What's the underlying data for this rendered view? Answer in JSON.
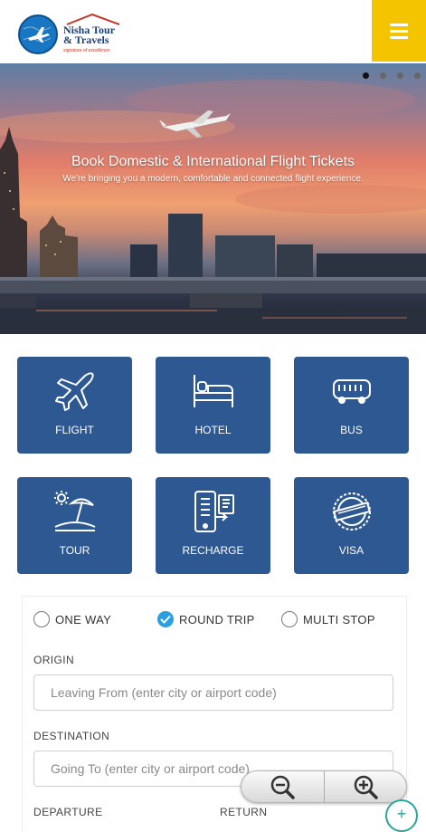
{
  "brand": {
    "name_line1": "Nisha Tour",
    "name_line2": "& Travels",
    "tagline": "signature of excellence"
  },
  "hero": {
    "title": "Book Domestic & International Flight Tickets",
    "subtitle": "We're bringing you a modern, comfortable and connected flight experience.",
    "slide_count": 4,
    "active_slide": 1
  },
  "services": [
    {
      "label": "FLIGHT",
      "icon": "airplane-icon"
    },
    {
      "label": "HOTEL",
      "icon": "bed-icon"
    },
    {
      "label": "BUS",
      "icon": "bus-icon"
    },
    {
      "label": "TOUR",
      "icon": "beach-umbrella-icon"
    },
    {
      "label": "RECHARGE",
      "icon": "phone-recharge-icon"
    },
    {
      "label": "VISA",
      "icon": "visa-stamp-icon"
    }
  ],
  "search_form": {
    "trip_types": [
      {
        "label": "ONE WAY",
        "selected": false
      },
      {
        "label": "ROUND TRIP",
        "selected": true
      },
      {
        "label": "MULTI STOP",
        "selected": false
      }
    ],
    "origin_label": "ORIGIN",
    "origin_placeholder": "Leaving From (enter city or airport code)",
    "destination_label": "DESTINATION",
    "destination_placeholder": "Going To (enter city or airport code)",
    "departure_label": "DEPARTURE",
    "return_label": "RETURN"
  },
  "colors": {
    "tile_blue": "#2d5892",
    "menu_yellow": "#f5c400",
    "radio_checked": "#2b9fe0"
  }
}
